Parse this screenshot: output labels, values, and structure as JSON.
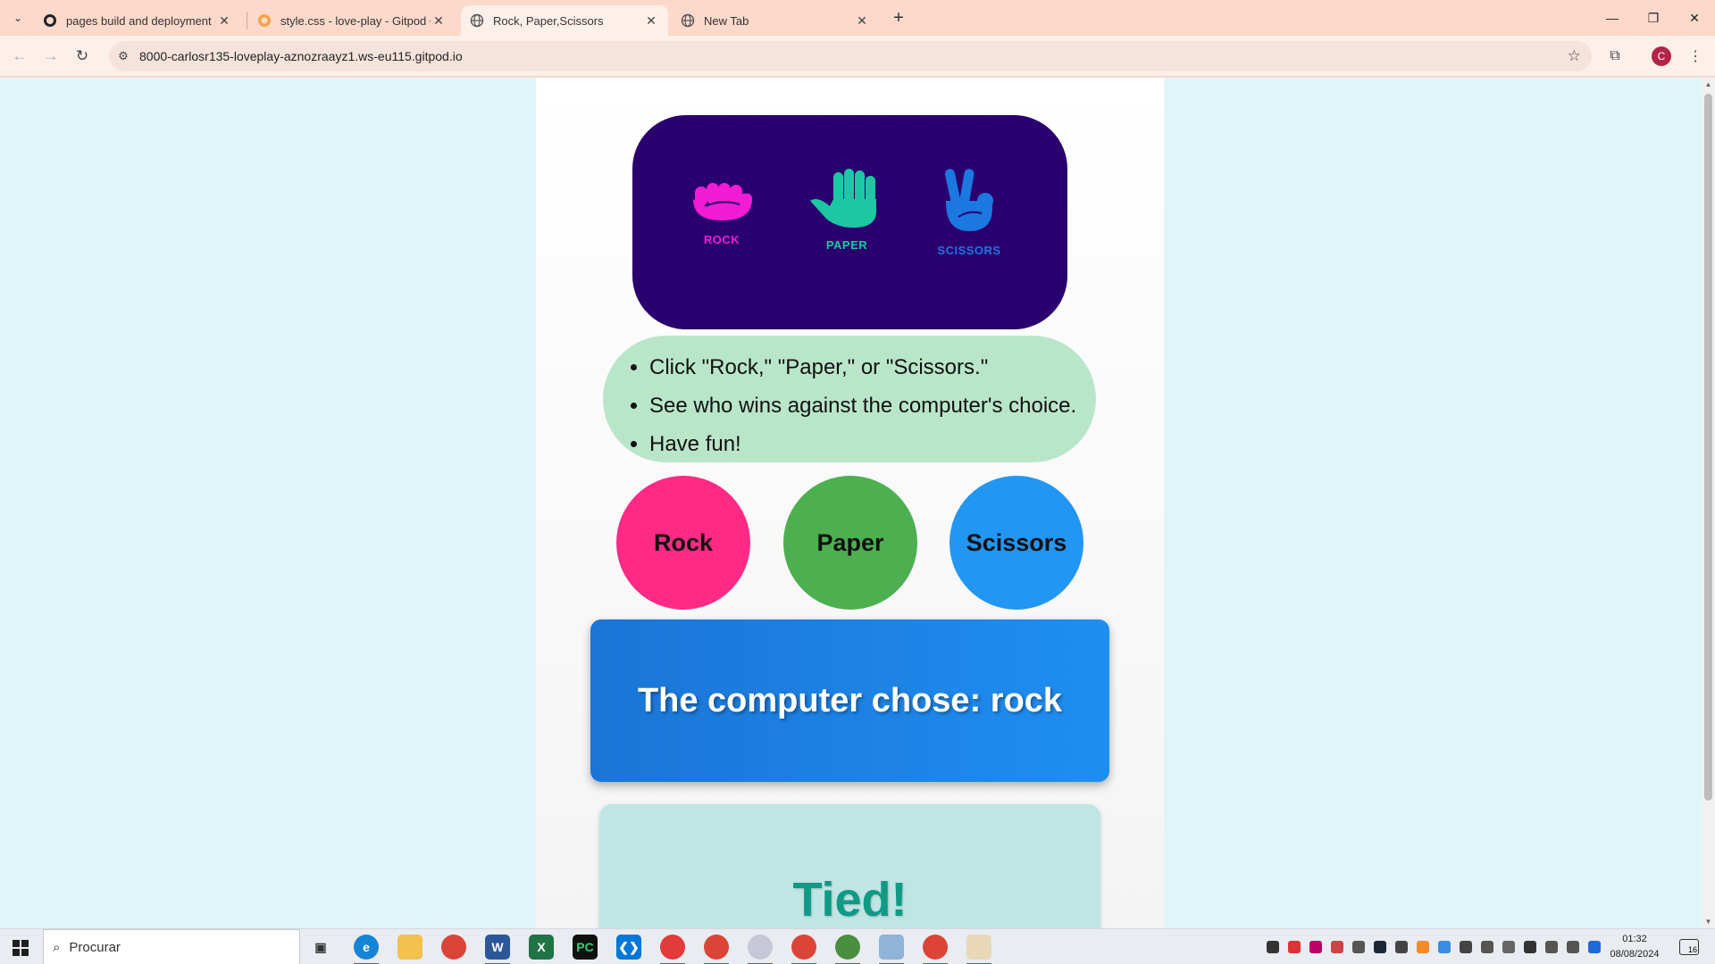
{
  "browser": {
    "tabs": [
      {
        "title": "pages build and deployment · C",
        "active": false
      },
      {
        "title": "style.css - love-play - Gitpod Cc",
        "active": false
      },
      {
        "title": "Rock, Paper,Scissors",
        "active": true
      },
      {
        "title": "New Tab",
        "active": false
      }
    ],
    "url": "8000-carlosr135-loveplay-aznozraayz1.ws-eu115.gitpod.io",
    "profile_initial": "C"
  },
  "page": {
    "choices": [
      {
        "label": "ROCK",
        "icon": "fist-icon",
        "color": "#f21bd6"
      },
      {
        "label": "PAPER",
        "icon": "open-hand-icon",
        "color": "#1cc7a3"
      },
      {
        "label": "SCISSORS",
        "icon": "peace-hand-icon",
        "color": "#1a78e0"
      }
    ],
    "instructions": [
      "Click \"Rock,\" \"Paper,\" or \"Scissors.\"",
      "See who wins against the computer's choice.",
      "Have fun!"
    ],
    "buttons": [
      {
        "label": "Rock",
        "color": "#ff2a86"
      },
      {
        "label": "Paper",
        "color": "#4caf50"
      },
      {
        "label": "Scissors",
        "color": "#2196f3"
      }
    ],
    "computer_choice_text": "The computer chose: rock",
    "result_text": "Tied!"
  },
  "taskbar": {
    "search_placeholder": "Procurar",
    "time": "01:32",
    "date": "08/08/2024",
    "notification_count": "16"
  }
}
